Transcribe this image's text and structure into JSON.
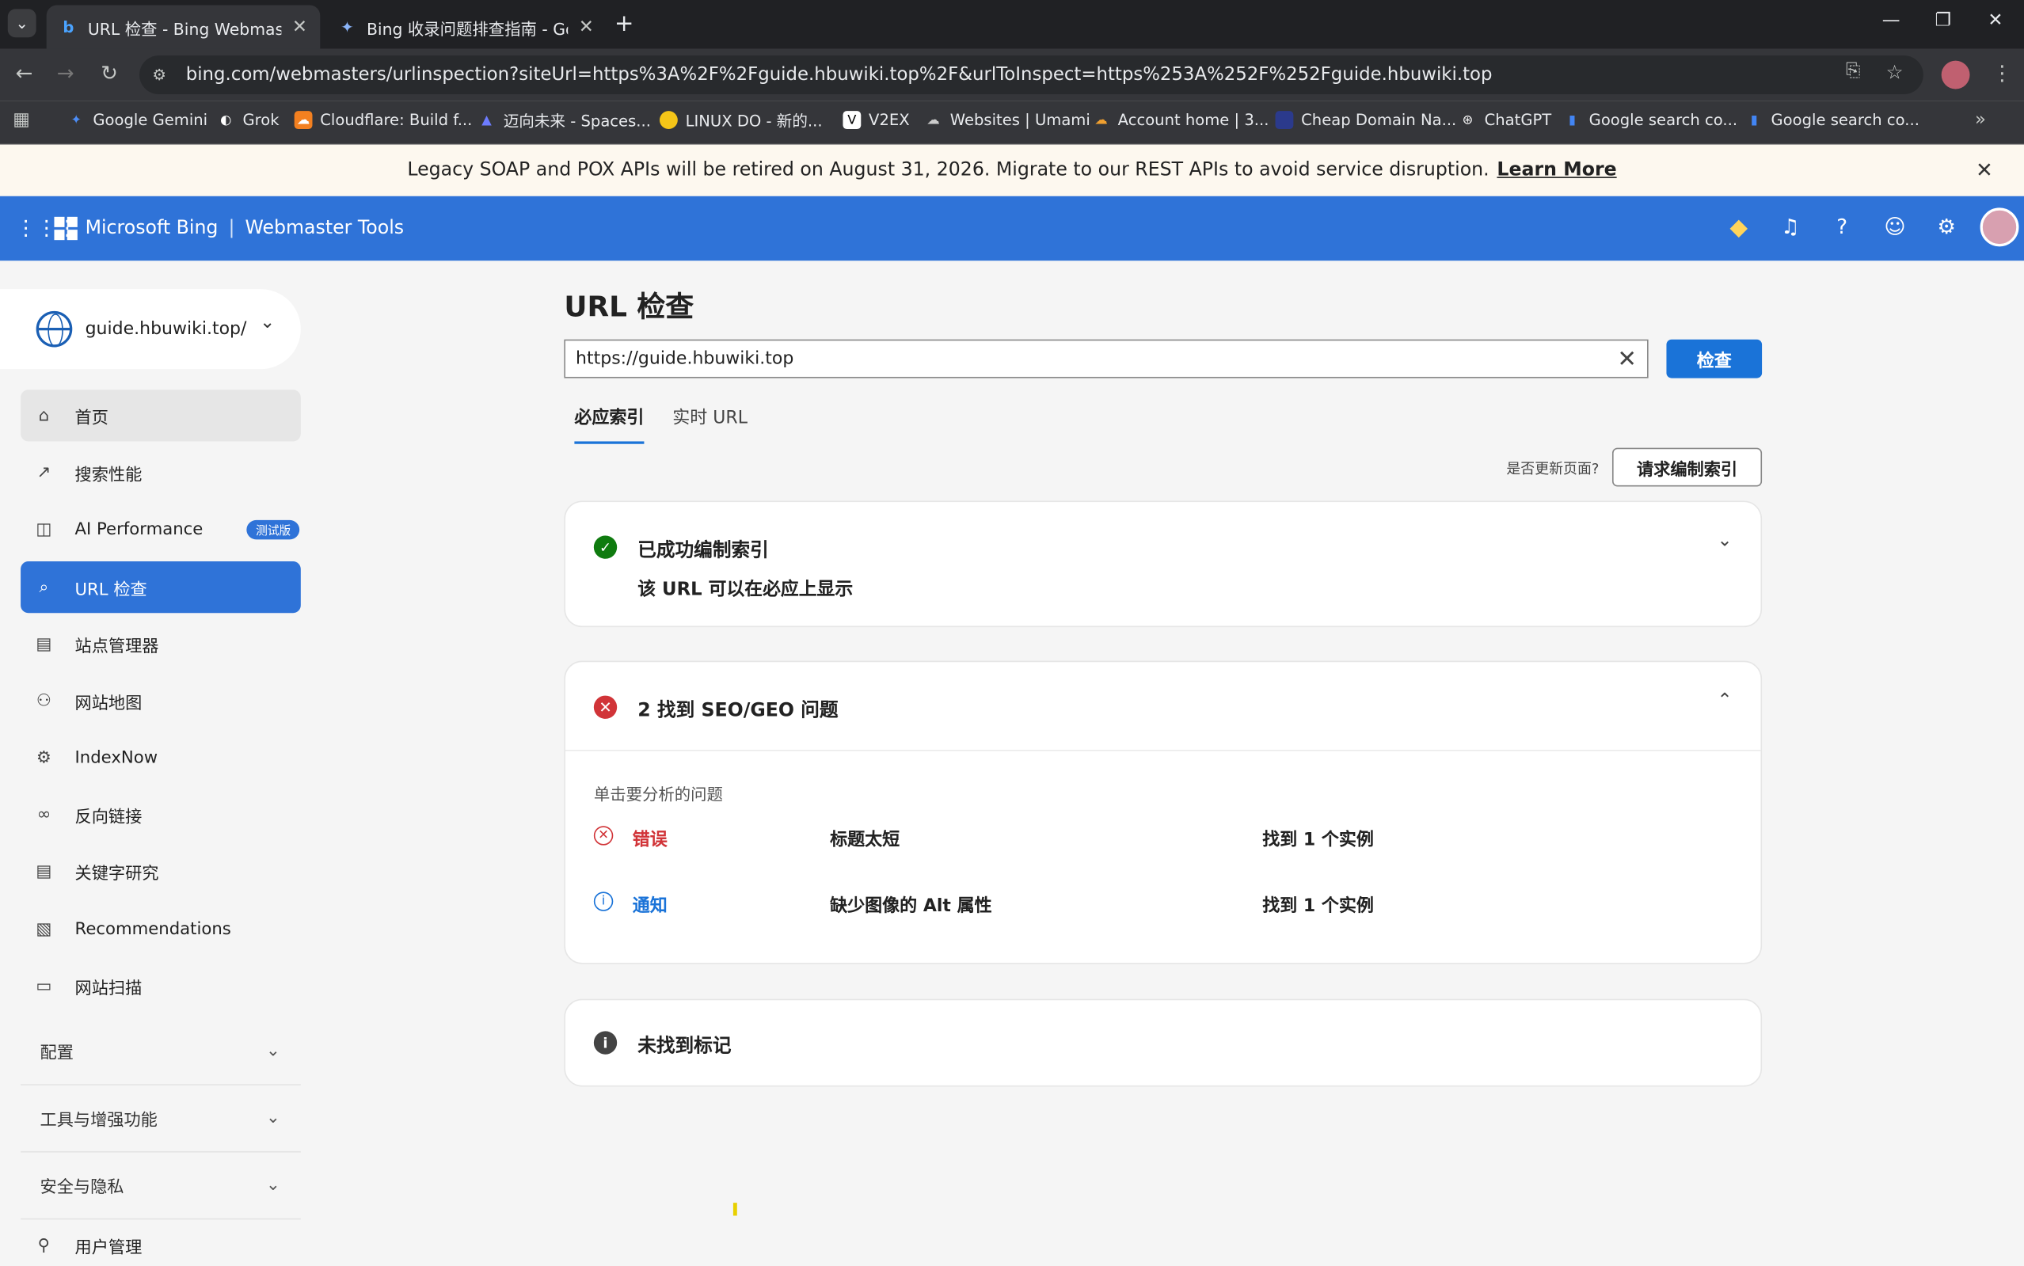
{
  "browser": {
    "tabs": [
      {
        "title": "URL 检查 - Bing Webmaster T",
        "favicon": "bing-icon",
        "active": true
      },
      {
        "title": "Bing 收录问题排查指南 - Goo",
        "favicon": "gemini-icon",
        "active": false
      }
    ],
    "url": "bing.com/webmasters/urlinspection?siteUrl=https%3A%2F%2Fguide.hbuwiki.top%2F&urlToInspect=https%253A%252F%252Fguide.hbuwiki.top",
    "bookmarks": [
      {
        "label": "Google Gemini",
        "color": "#4c8df6"
      },
      {
        "label": "Grok",
        "color": "#ffffff"
      },
      {
        "label": "Cloudflare: Build f...",
        "color": "#f38020"
      },
      {
        "label": "迈向未来 - Spaces...",
        "color": "#4b5be0"
      },
      {
        "label": "LINUX DO - 新的...",
        "color": "#f5c518"
      },
      {
        "label": "V2EX",
        "color": "#ffffff"
      },
      {
        "label": "Websites | Umami",
        "color": "#aaaaaa"
      },
      {
        "label": "Account home | 3...",
        "color": "#f0a030"
      },
      {
        "label": "Cheap Domain Na...",
        "color": "#2b3a8c"
      },
      {
        "label": "ChatGPT",
        "color": "#ffffff"
      },
      {
        "label": "Google search co...",
        "color": "#4285f4"
      },
      {
        "label": "Google search co...",
        "color": "#4285f4"
      }
    ]
  },
  "banner": {
    "text": "Legacy SOAP and POX APIs will be retired on August 31, 2026. Migrate to our REST APIs to avoid service disruption.",
    "link": "Learn More"
  },
  "header": {
    "brand": "Microsoft Bing",
    "product": "Webmaster Tools",
    "accent": "#2f73d8"
  },
  "sidebar": {
    "site": "guide.hbuwiki.top/",
    "items": [
      {
        "label": "首页",
        "icon": "home-icon"
      },
      {
        "label": "搜索性能",
        "icon": "trend-icon"
      },
      {
        "label": "AI Performance",
        "icon": "chart-icon",
        "badge": "测试版"
      },
      {
        "label": "URL 检查",
        "icon": "search-icon"
      },
      {
        "label": "站点管理器",
        "icon": "document-icon"
      },
      {
        "label": "网站地图",
        "icon": "sitemap-icon"
      },
      {
        "label": "IndexNow",
        "icon": "gear-icon"
      },
      {
        "label": "反向链接",
        "icon": "link-icon"
      },
      {
        "label": "关键字研究",
        "icon": "document-icon"
      },
      {
        "label": "Recommendations",
        "icon": "document-search-icon"
      },
      {
        "label": "网站扫描",
        "icon": "scan-icon"
      }
    ],
    "sections": [
      "配置",
      "工具与增强功能",
      "安全与隐私"
    ],
    "user_mgmt": "用户管理"
  },
  "main": {
    "title": "URL 检查",
    "input_value": "https://guide.hbuwiki.top",
    "inspect_button": "检查",
    "tabs": [
      "必应索引",
      "实时 URL"
    ],
    "update_question": "是否更新页面?",
    "request_button": "请求编制索引",
    "index_card": {
      "title": "已成功编制索引",
      "subtitle": "该 URL 可以在必应上显示"
    },
    "seo_card": {
      "title": "2 找到 SEO/GEO 问题",
      "hint": "单击要分析的问题",
      "issues": [
        {
          "severity": "错误",
          "issue": "标题太短",
          "count": "找到 1 个实例",
          "color": "#d13438"
        },
        {
          "severity": "通知",
          "issue": "缺少图像的 Alt 属性",
          "count": "找到 1 个实例",
          "color": "#1a73d8"
        }
      ]
    },
    "markup_card": {
      "title": "未找到标记"
    }
  }
}
